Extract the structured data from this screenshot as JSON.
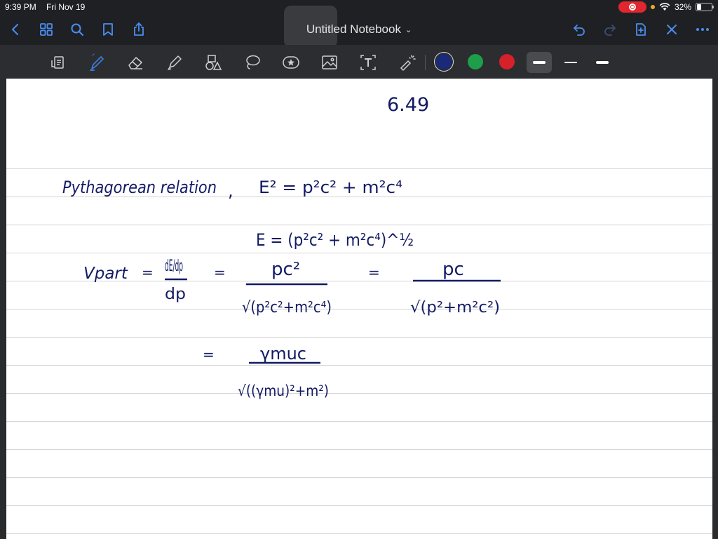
{
  "status_bar": {
    "time": "9:39 PM",
    "date": "Fri Nov 19",
    "battery_percent": "32%",
    "battery_level": 0.32,
    "icons": [
      "screen-record-icon",
      "orange-dot-indicator",
      "wifi-icon",
      "battery-icon"
    ]
  },
  "nav": {
    "title": "Untitled Notebook",
    "icons": [
      "back-chevron-icon",
      "thumbnails-grid-icon",
      "search-icon",
      "bookmark-icon",
      "share-icon",
      "undo-icon",
      "redo-icon",
      "add-page-icon",
      "close-icon",
      "more-icon"
    ]
  },
  "toolbar": {
    "tools": [
      "document-scan-icon",
      "pen-icon",
      "eraser-icon",
      "highlighter-icon",
      "shapes-icon",
      "lasso-icon",
      "elements-star-icon",
      "image-icon",
      "text-icon",
      "laser-pointer-icon"
    ],
    "active_tool": "pen-icon",
    "colors": [
      "#1a2a7a",
      "#1e9e4a",
      "#d6202a"
    ],
    "selected_color": "#1a2a7a",
    "stroke_widths": [
      "thick",
      "medium",
      "thin"
    ],
    "selected_stroke": "thick"
  },
  "page": {
    "background": "#ffffff",
    "ink_color": "#131a66",
    "handwriting": {
      "problem_number": "6.49",
      "line1_label": "Pythagorean relation",
      "line1_equation": "E² = p²c² + m²c⁴",
      "line2_equation": "E = (p²c² + m²c⁴)^½",
      "line3_lhs": "Vpart",
      "line3_derivative": "dE/dp",
      "line3_fraction1_num": "pc²",
      "line3_fraction1_den": "√(p²c²+m²c⁴)",
      "line3_fraction2_num": "pc",
      "line3_fraction2_den": "√(p²+m²c²)",
      "line4_fraction_num": "γmuc",
      "line4_fraction_den": "√((γmu)²+m²)"
    }
  }
}
